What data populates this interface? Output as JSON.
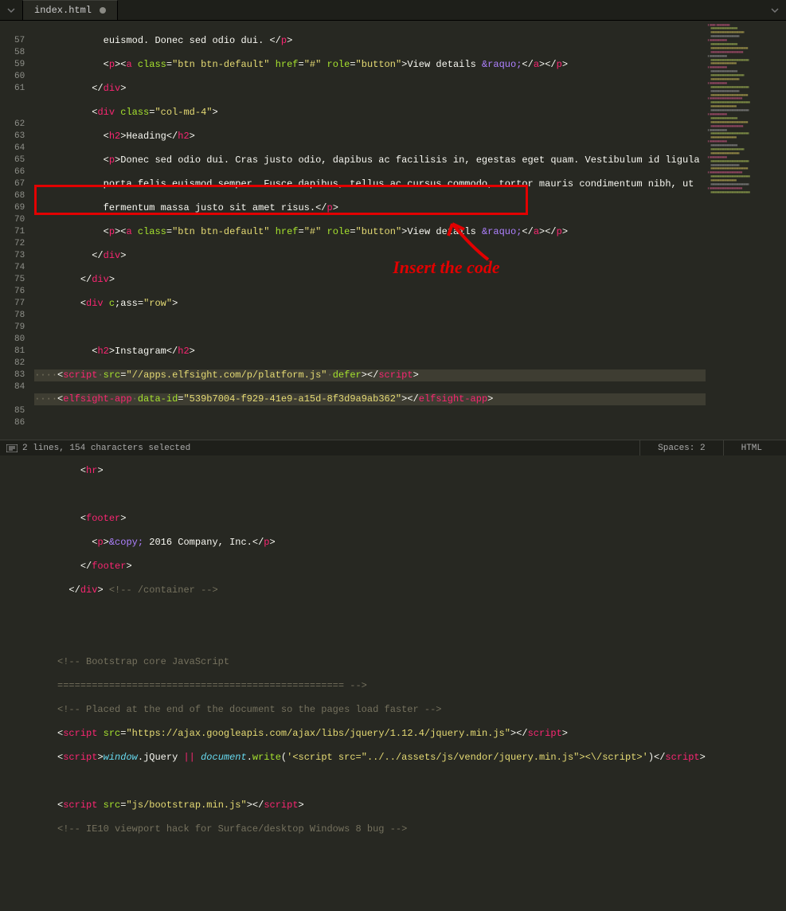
{
  "tab": {
    "filename": "index.html",
    "dirty": true
  },
  "gutter": [
    "",
    "57",
    "58",
    "59",
    "60",
    "61",
    "",
    "",
    "62",
    "63",
    "64",
    "65",
    "66",
    "67",
    "68",
    "69",
    "70",
    "71",
    "72",
    "73",
    "74",
    "75",
    "76",
    "77",
    "78",
    "79",
    "80",
    "81",
    "82",
    "83",
    "84",
    "",
    "85",
    "86"
  ],
  "code": {
    "l0": "            euismod. Donec sed odio dui. </p>",
    "l1a": "            <p><a class=\"btn btn-default\" href=\"#\" role=\"button\">",
    "l1b": "View details &raquo;</a></p>",
    "l2": "          </div>",
    "l3": "          <div class=\"col-md-4\">",
    "l4": "            <h2>Heading</h2>",
    "l5": "            <p>Donec sed odio dui. Cras justo odio, dapibus ac facilisis in, egestas eget quam. Vestibulum id ligula",
    "l6": "            porta felis euismod semper. Fusce dapibus, tellus ac cursus commodo, tortor mauris condimentum nibh, ut",
    "l7": "            fermentum massa justo sit amet risus.</p>",
    "l8a": "            <p><a class=\"btn btn-default\" href=\"#\" role=\"button\">",
    "l8b": "View details &raquo;</a></p>",
    "l9": "          </div>",
    "l10": "        </div>",
    "l11": "        <div c;ass=\"row\">",
    "l12": "",
    "l13": "          <h2>Instagram</h2>",
    "l14": "····<script·src=\"//apps.elfsight.com/p/platform.js\"·defer></script>",
    "l15": "····<elfsight-app·data-id=\"539b7004-f929-41e9-a15d-8f3d9a9ab362\"></elfsight-app>",
    "l16": "",
    "l17": "        </div>",
    "l18": "        <hr>",
    "l19": "",
    "l20": "        <footer>",
    "l21": "          <p>&copy; 2016 Company, Inc.</p>",
    "l22": "        </footer>",
    "l23": "      </div> <!-- /container -->",
    "l24": "",
    "l25": "",
    "l26": "    <!-- Bootstrap core JavaScript",
    "l27": "    ================================================== -->",
    "l28": "    <!-- Placed at the end of the document so the pages load faster -->",
    "l29": "    <script src=\"https://ajax.googleapis.com/ajax/libs/jquery/1.12.4/jquery.min.js\"></script>",
    "l30a": "    <script>window.jQuery || document.write('<script src=\"../../assets/js/vendor/jquery.min.js\"><\\/script>",
    "l30b": "')</script>",
    "l31": "    <script src=\"js/bootstrap.min.js\"></script>",
    "l32": "    <!-- IE10 viewport hack for Surface/desktop Windows 8 bug -->"
  },
  "annotation": "Insert the code",
  "status": {
    "selection": "2 lines, 154 characters selected",
    "spaces": "Spaces: 2",
    "syntax": "HTML"
  },
  "highlight": {
    "lines_start": 68,
    "lines_end": 69
  }
}
